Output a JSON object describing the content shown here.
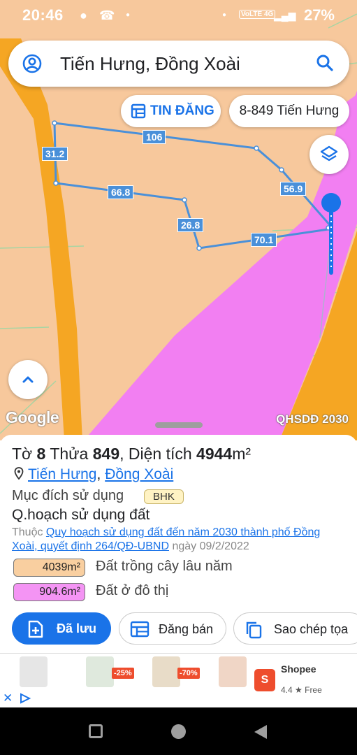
{
  "status_bar": {
    "time": "20:46",
    "network": "VoLTE 4G",
    "battery": "27%"
  },
  "search": {
    "query": "Tiến Hưng, Đồng Xoài"
  },
  "chips": {
    "listing": "TIN ĐĂNG",
    "address": "8-849 Tiến Hưng"
  },
  "map": {
    "attribution": "Google",
    "layer_label": "QHSDĐ 2030",
    "dimensions": [
      "106",
      "31.2",
      "66.8",
      "26.8",
      "70.1",
      "56.9"
    ],
    "colors": {
      "background": "#f7c89c",
      "road": "#f5a623",
      "urban_zone": "#f27ff2",
      "boundary": "#4a90d9"
    }
  },
  "parcel": {
    "sheet_prefix": "Tờ",
    "sheet_no": "8",
    "parcel_prefix": "Thửa",
    "parcel_no": "849",
    "area_prefix": ", Diện tích",
    "area_value": "4944",
    "area_unit": "m²",
    "ward": "Tiến Hưng",
    "separator": ",",
    "city": "Đồng Xoài",
    "purpose_label": "Mục đích sử dụng",
    "purpose_code": "BHK",
    "plan_title": "Q.hoạch sử dụng đất",
    "plan_prefix": "Thuộc",
    "plan_link": "Quy hoạch sử dụng đất đến năm 2030 thành phố Đồng Xoài, quyết định 264/QĐ-UBND",
    "plan_date": "ngày 09/2/2022",
    "zones": [
      {
        "area": "4039m²",
        "label": "Đất trồng cây lâu năm",
        "color": "#f9cfa0"
      },
      {
        "area": "904.6m²",
        "label": "Đất ở đô thị",
        "color": "#f494f4"
      }
    ]
  },
  "actions": {
    "saved": "Đã lưu",
    "post": "Đăng bán",
    "copy": "Sao chép tọa"
  },
  "ad": {
    "discounts": [
      "-25%",
      "-70%"
    ],
    "shop_name": "Shopee",
    "rating": "4.4 ★ Free",
    "logo_letter": "S"
  }
}
